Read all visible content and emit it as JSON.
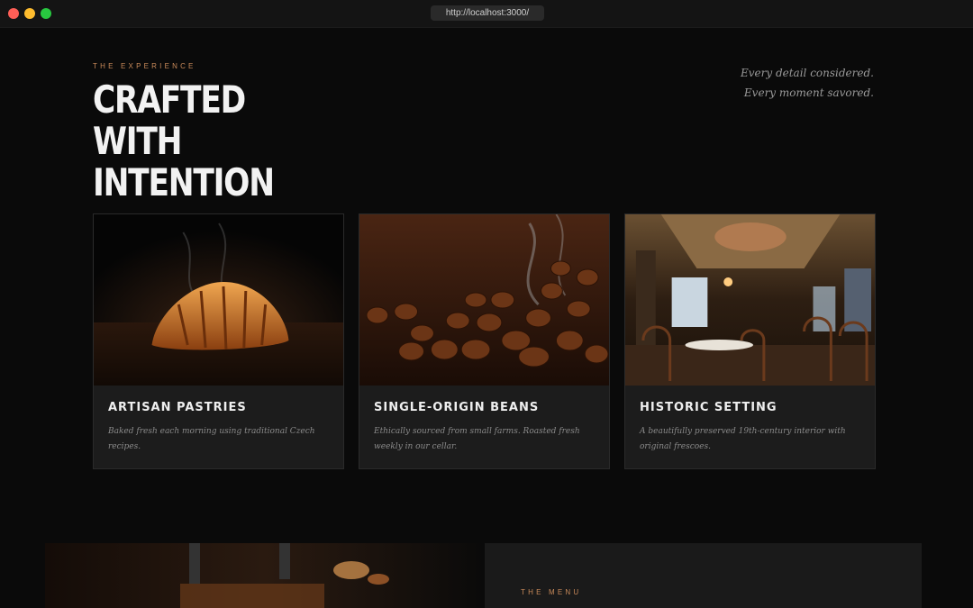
{
  "browser": {
    "url": "http://localhost:3000/"
  },
  "experience": {
    "eyebrow": "THE EXPERIENCE",
    "headline_line1": "CRAFTED WITH",
    "headline_line2": "INTENTION",
    "tagline_line1": "Every detail considered.",
    "tagline_line2": "Every moment savored."
  },
  "cards": [
    {
      "title": "ARTISAN PASTRIES",
      "description": "Baked fresh each morning using traditional Czech recipes.",
      "image": "croissant-photo"
    },
    {
      "title": "SINGLE-ORIGIN BEANS",
      "description": "Ethically sourced from small farms. Roasted fresh weekly in our cellar.",
      "image": "coffee-beans-photo"
    },
    {
      "title": "HISTORIC SETTING",
      "description": "A beautifully preserved 19th-century interior with original frescoes.",
      "image": "cafe-interior-photo"
    }
  ],
  "menu": {
    "eyebrow": "THE MENU"
  },
  "colors": {
    "background": "#0a0a0a",
    "accent": "#c98a5a",
    "card": "#1c1c1c"
  }
}
